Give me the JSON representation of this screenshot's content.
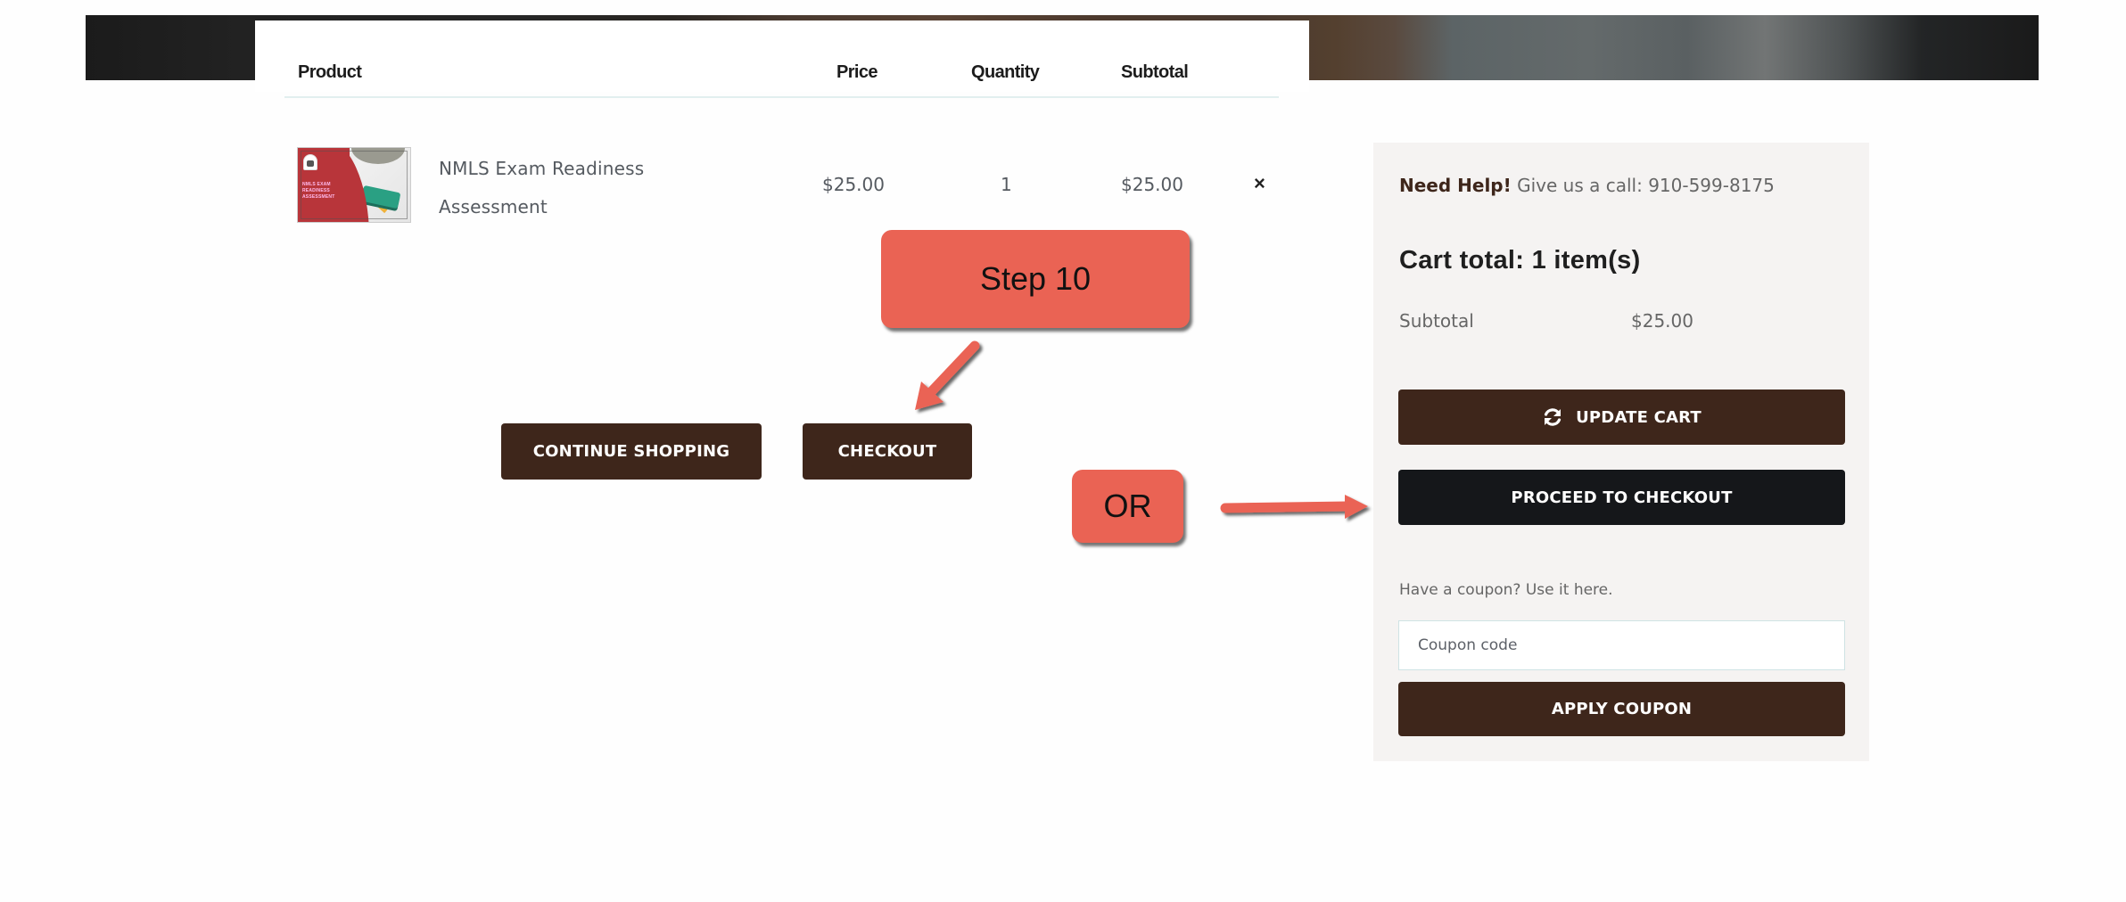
{
  "table": {
    "headers": {
      "product": "Product",
      "price": "Price",
      "quantity": "Quantity",
      "subtotal": "Subtotal"
    },
    "rows": [
      {
        "thumbnail_text": "NMLS EXAM READINESS ASSESSMENT",
        "name": "NMLS Exam Readiness Assessment",
        "price": "$25.00",
        "quantity": "1",
        "subtotal": "$25.00",
        "remove_icon": "×"
      }
    ]
  },
  "actions": {
    "continue_shopping": "CONTINUE SHOPPING",
    "checkout": "CHECKOUT"
  },
  "annotations": {
    "step_label": "Step 10",
    "or_label": "OR",
    "color": "#ea6354"
  },
  "sidebar": {
    "help_bold": "Need Help!",
    "help_text": " Give us a call: 910-599-8175",
    "cart_total": "Cart total: 1 item(s)",
    "subtotal_label": "Subtotal",
    "subtotal_value": "$25.00",
    "update_cart": "UPDATE CART",
    "update_cart_icon": "refresh-icon",
    "proceed_to_checkout": "PROCEED TO CHECKOUT",
    "coupon_label": "Have a coupon? Use it here.",
    "coupon_placeholder": "Coupon code",
    "coupon_value": "",
    "apply_coupon": "APPLY COUPON"
  },
  "colors": {
    "button_brown": "#3e261b",
    "button_black": "#15171a",
    "panel_bg": "#f5f3f2"
  }
}
